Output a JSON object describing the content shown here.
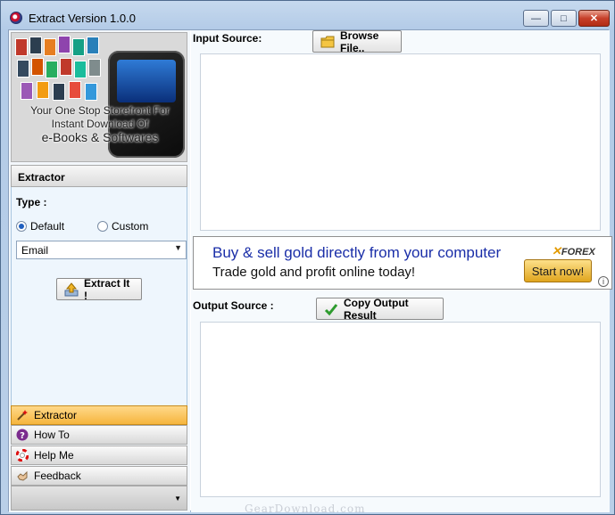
{
  "window": {
    "title": "Extract Version 1.0.0"
  },
  "banner": {
    "line1": "Your One Stop Storefront For",
    "line2": "Instant Download Of",
    "line3": "e-Books & Softwares"
  },
  "left": {
    "section_title": "Extractor",
    "type_label": "Type :",
    "radio_default": "Default",
    "radio_custom": "Custom",
    "selected_radio": "Default",
    "select_value": "Email",
    "extract_button": "Extract It !",
    "nav": [
      {
        "label": "Extractor",
        "icon": "magic-wand-icon",
        "active": true
      },
      {
        "label": "How To",
        "icon": "question-icon",
        "active": false
      },
      {
        "label": "Help Me",
        "icon": "lifebuoy-icon",
        "active": false
      },
      {
        "label": "Feedback",
        "icon": "feedback-icon",
        "active": false
      }
    ]
  },
  "right": {
    "input_label": "Input Source:",
    "browse_button": "Browse File..",
    "output_label": "Output Source :",
    "copy_button": "Copy Output Result",
    "input_value": "",
    "output_value": ""
  },
  "ad": {
    "headline": "Buy & sell gold directly from your computer",
    "subline": "Trade gold and profit online today!",
    "brand": "FOREX",
    "cta": "Start now!"
  },
  "watermark": "GearDownload.com",
  "colors": {
    "accent": "#1a2ea8",
    "nav_active": "#f6b53d"
  }
}
